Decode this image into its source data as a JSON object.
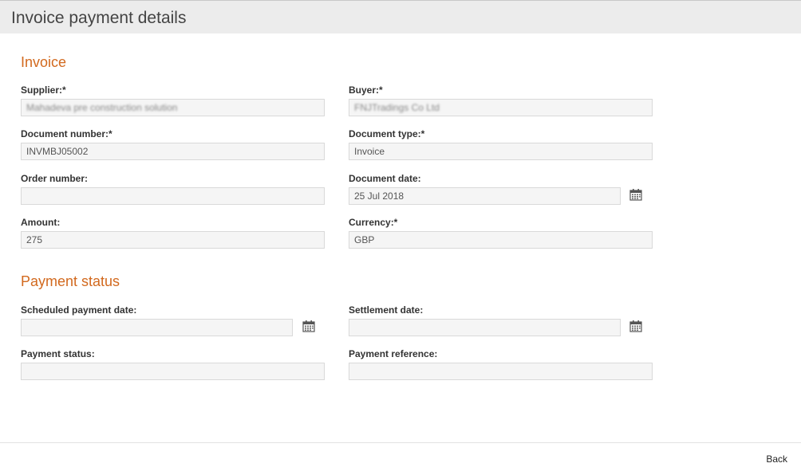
{
  "header": {
    "title": "Invoice payment details"
  },
  "invoice_section": {
    "title": "Invoice",
    "supplier": {
      "label": "Supplier:*",
      "value": "Mahadeva pre construction solution"
    },
    "buyer": {
      "label": "Buyer:*",
      "value": "FNJTradings Co Ltd"
    },
    "document_number": {
      "label": "Document number:*",
      "value": "INVMBJ05002"
    },
    "document_type": {
      "label": "Document type:*",
      "value": "Invoice"
    },
    "order_number": {
      "label": "Order number:",
      "value": ""
    },
    "document_date": {
      "label": "Document date:",
      "value": "25 Jul 2018"
    },
    "amount": {
      "label": "Amount:",
      "value": "275"
    },
    "currency": {
      "label": "Currency:*",
      "value": "GBP"
    }
  },
  "payment_section": {
    "title": "Payment status",
    "scheduled_payment_date": {
      "label": "Scheduled payment date:",
      "value": ""
    },
    "settlement_date": {
      "label": "Settlement date:",
      "value": ""
    },
    "payment_status": {
      "label": "Payment status:",
      "value": ""
    },
    "payment_reference": {
      "label": "Payment reference:",
      "value": ""
    }
  },
  "footer": {
    "back_label": "Back"
  }
}
